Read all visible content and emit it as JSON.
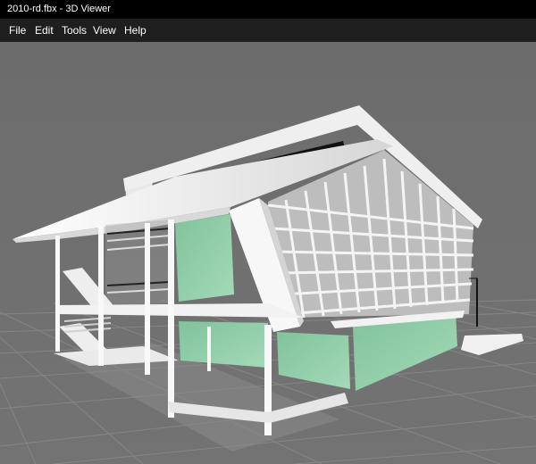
{
  "window": {
    "title": "2010-rd.fbx - 3D Viewer"
  },
  "menubar": {
    "items": [
      {
        "label": "File"
      },
      {
        "label": "Edit"
      },
      {
        "label": "Tools"
      },
      {
        "label": "View"
      },
      {
        "label": "Help"
      }
    ]
  },
  "viewport": {
    "background_color": "#6e6e6e",
    "grid_color": "#858585",
    "model": {
      "glass_color": "#8fcaa6",
      "structure_color": "#f0f0f0",
      "shadow_color": "#c9c9c9"
    }
  }
}
